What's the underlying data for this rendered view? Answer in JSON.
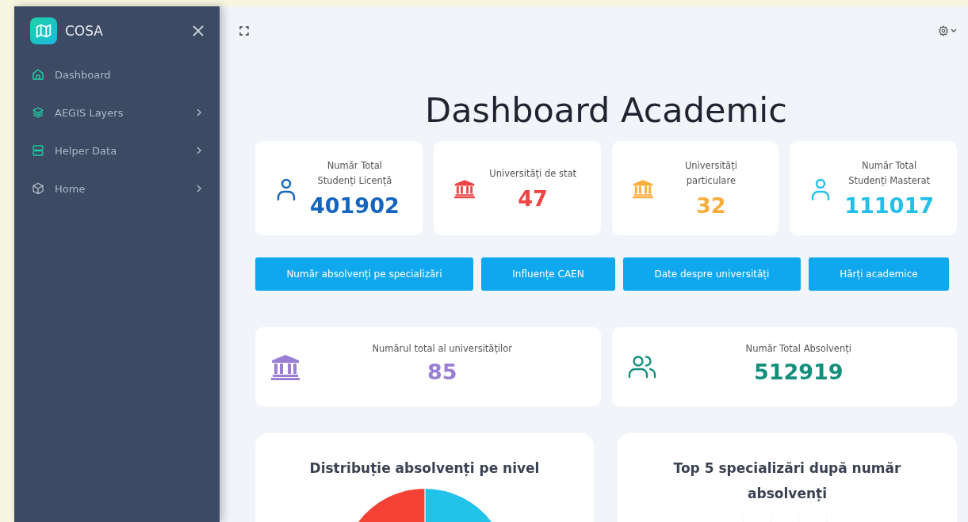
{
  "sidebar": {
    "brand": "COSA",
    "items": [
      {
        "label": "Dashboard",
        "kind": "home",
        "expandable": false
      },
      {
        "label": "AEGIS Layers",
        "kind": "layers",
        "expandable": true
      },
      {
        "label": "Helper Data",
        "kind": "server",
        "expandable": true
      },
      {
        "label": "Home",
        "kind": "cube",
        "expandable": true
      }
    ]
  },
  "page_title": "Dashboard Academic",
  "stat_cards": [
    {
      "label": "Număr Total Studenți Licență",
      "value": "401902",
      "kind": "user",
      "color": "#1565c0"
    },
    {
      "label": "Universități de stat",
      "value": "47",
      "kind": "bank",
      "color": "#ef4444"
    },
    {
      "label": "Universități particulare",
      "value": "32",
      "kind": "bank",
      "color": "#fbad3c"
    },
    {
      "label": "Număr Total Studenți Masterat",
      "value": "111017",
      "kind": "user",
      "color": "#22c0e8"
    }
  ],
  "buttons": [
    "Număr absolvenți pe specializări",
    "Influențe CAEN",
    "Date despre universități",
    "Hărți academice"
  ],
  "summary_cards": [
    {
      "label": "Numărul total al universităților",
      "value": "85",
      "kind": "bank",
      "color": "#9b7fd4"
    },
    {
      "label": "Număr Total Absolvenți",
      "value": "512919",
      "kind": "users",
      "color": "#138f7d"
    }
  ],
  "chart_cards": [
    {
      "title": "Distribuție absolvenți pe nivel",
      "kind": "pie"
    },
    {
      "title": "Top 5 specializări după număr absolvenți",
      "kind": "bar"
    }
  ]
}
